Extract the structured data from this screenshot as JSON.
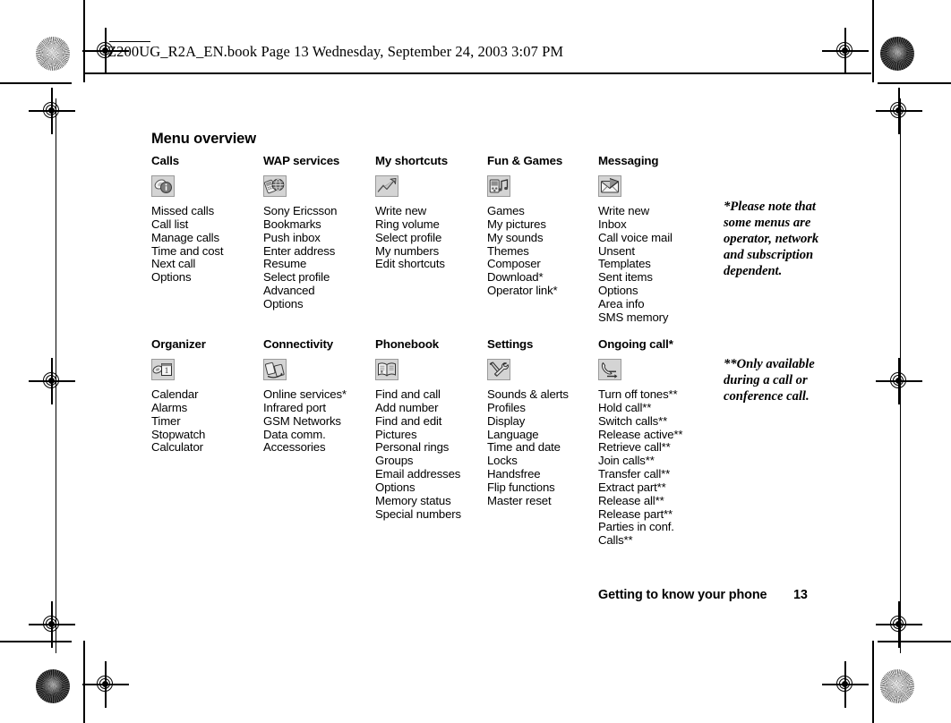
{
  "header": {
    "file_line": "Z200UG_R2A_EN.book  Page 13  Wednesday, September 24, 2003  3:07 PM"
  },
  "page_title": "Menu overview",
  "columns": [
    {
      "id": "calls",
      "heading": "Calls",
      "icon": "calls-icon",
      "items": [
        "Missed calls",
        "Call list",
        "Manage calls",
        "Time and cost",
        "Next call",
        "Options"
      ]
    },
    {
      "id": "wap-services",
      "heading": "WAP services",
      "icon": "wap-services-icon",
      "items": [
        "Sony Ericsson",
        "Bookmarks",
        "Push inbox",
        "Enter address",
        "Resume",
        "Select profile",
        "Advanced",
        "Options"
      ]
    },
    {
      "id": "my-shortcuts",
      "heading": "My shortcuts",
      "icon": "my-shortcuts-icon",
      "items": [
        "Write new",
        "Ring volume",
        "Select profile",
        "My numbers",
        "Edit shortcuts"
      ]
    },
    {
      "id": "fun-and-games",
      "heading": "Fun & Games",
      "icon": "fun-and-games-icon",
      "items": [
        "Games",
        "My pictures",
        "My sounds",
        "Themes",
        "Composer",
        "Download*",
        "Operator link*"
      ]
    },
    {
      "id": "messaging",
      "heading": "Messaging",
      "icon": "messaging-icon",
      "items": [
        "Write new",
        "Inbox",
        "Call voice mail",
        "Unsent",
        "Templates",
        "Sent items",
        "Options",
        "Area info",
        "SMS memory"
      ]
    },
    {
      "id": "organizer",
      "heading": "Organizer",
      "icon": "organizer-icon",
      "items": [
        "Calendar",
        "Alarms",
        "Timer",
        "Stopwatch",
        "Calculator"
      ]
    },
    {
      "id": "connectivity",
      "heading": "Connectivity",
      "icon": "connectivity-icon",
      "items": [
        "Online services*",
        "Infrared port",
        "GSM Networks",
        "Data comm.",
        "Accessories"
      ]
    },
    {
      "id": "phonebook",
      "heading": "Phonebook",
      "icon": "phonebook-icon",
      "items": [
        "Find and call",
        "Add number",
        "Find and edit",
        "Pictures",
        "Personal rings",
        "Groups",
        "Email addresses",
        "Options",
        "Memory status",
        "Special numbers"
      ]
    },
    {
      "id": "settings",
      "heading": "Settings",
      "icon": "settings-icon",
      "items": [
        "Sounds & alerts",
        "Profiles",
        "Display",
        "Language",
        "Time and date",
        "Locks",
        "Handsfree",
        "Flip functions",
        "Master reset"
      ]
    },
    {
      "id": "ongoing-call",
      "heading": "Ongoing call*",
      "icon": "ongoing-call-icon",
      "items": [
        "Turn off tones**",
        "Hold call**",
        "Switch calls**",
        "Release active**",
        "Retrieve call**",
        "Join calls**",
        "Transfer call**",
        "Extract part**",
        "Release all**",
        "Release part**",
        "Parties in conf.",
        "Calls**"
      ]
    }
  ],
  "notes": {
    "single_star": "*Please note that some menus are operator, network and subscription dependent.",
    "double_star": "**Only available during a call or conference call."
  },
  "footer": {
    "chapter": "Getting to know your phone",
    "page_number": "13"
  },
  "colors": {
    "text": "#000000",
    "background": "#ffffff",
    "icon_frame": "#9a9a9a",
    "icon_fill": "#d4d4d4"
  }
}
